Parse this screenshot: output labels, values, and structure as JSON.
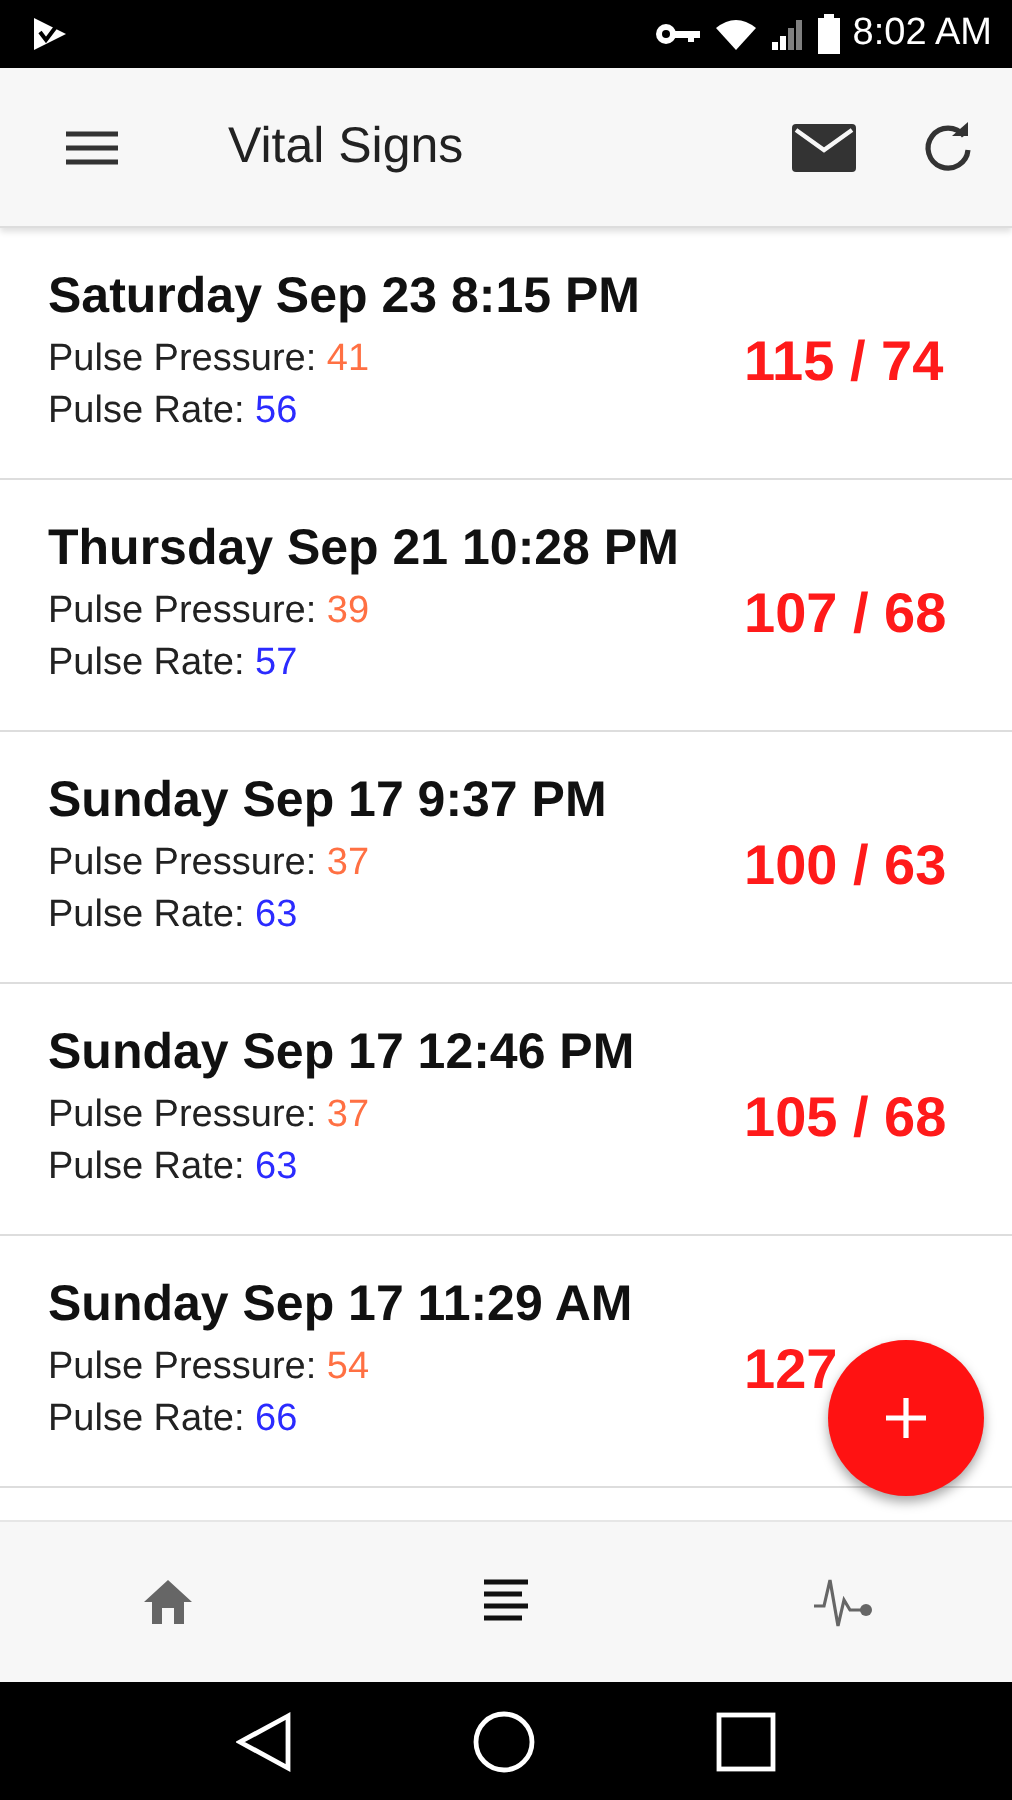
{
  "status_bar": {
    "time": "8:02 AM"
  },
  "app_bar": {
    "title": "Vital Signs"
  },
  "readings": [
    {
      "date": "Saturday Sep 23 8:15 PM",
      "pressure_label": "Pulse Pressure:",
      "pressure": "41",
      "rate_label": "Pulse Rate:",
      "rate": "56",
      "bp": "115 / 74"
    },
    {
      "date": "Thursday Sep 21 10:28 PM",
      "pressure_label": "Pulse Pressure:",
      "pressure": "39",
      "rate_label": "Pulse Rate:",
      "rate": "57",
      "bp": "107 / 68"
    },
    {
      "date": "Sunday Sep 17 9:37 PM",
      "pressure_label": "Pulse Pressure:",
      "pressure": "37",
      "rate_label": "Pulse Rate:",
      "rate": "63",
      "bp": "100 / 63"
    },
    {
      "date": "Sunday Sep 17 12:46 PM",
      "pressure_label": "Pulse Pressure:",
      "pressure": "37",
      "rate_label": "Pulse Rate:",
      "rate": "63",
      "bp": "105 / 68"
    },
    {
      "date": "Sunday Sep 17 11:29 AM",
      "pressure_label": "Pulse Pressure:",
      "pressure": "54",
      "rate_label": "Pulse Rate:",
      "rate": "66",
      "bp": "127"
    }
  ],
  "bottom_nav": [
    {
      "kind": "home",
      "selected": false
    },
    {
      "kind": "list",
      "selected": true
    },
    {
      "kind": "pulse",
      "selected": false
    }
  ]
}
